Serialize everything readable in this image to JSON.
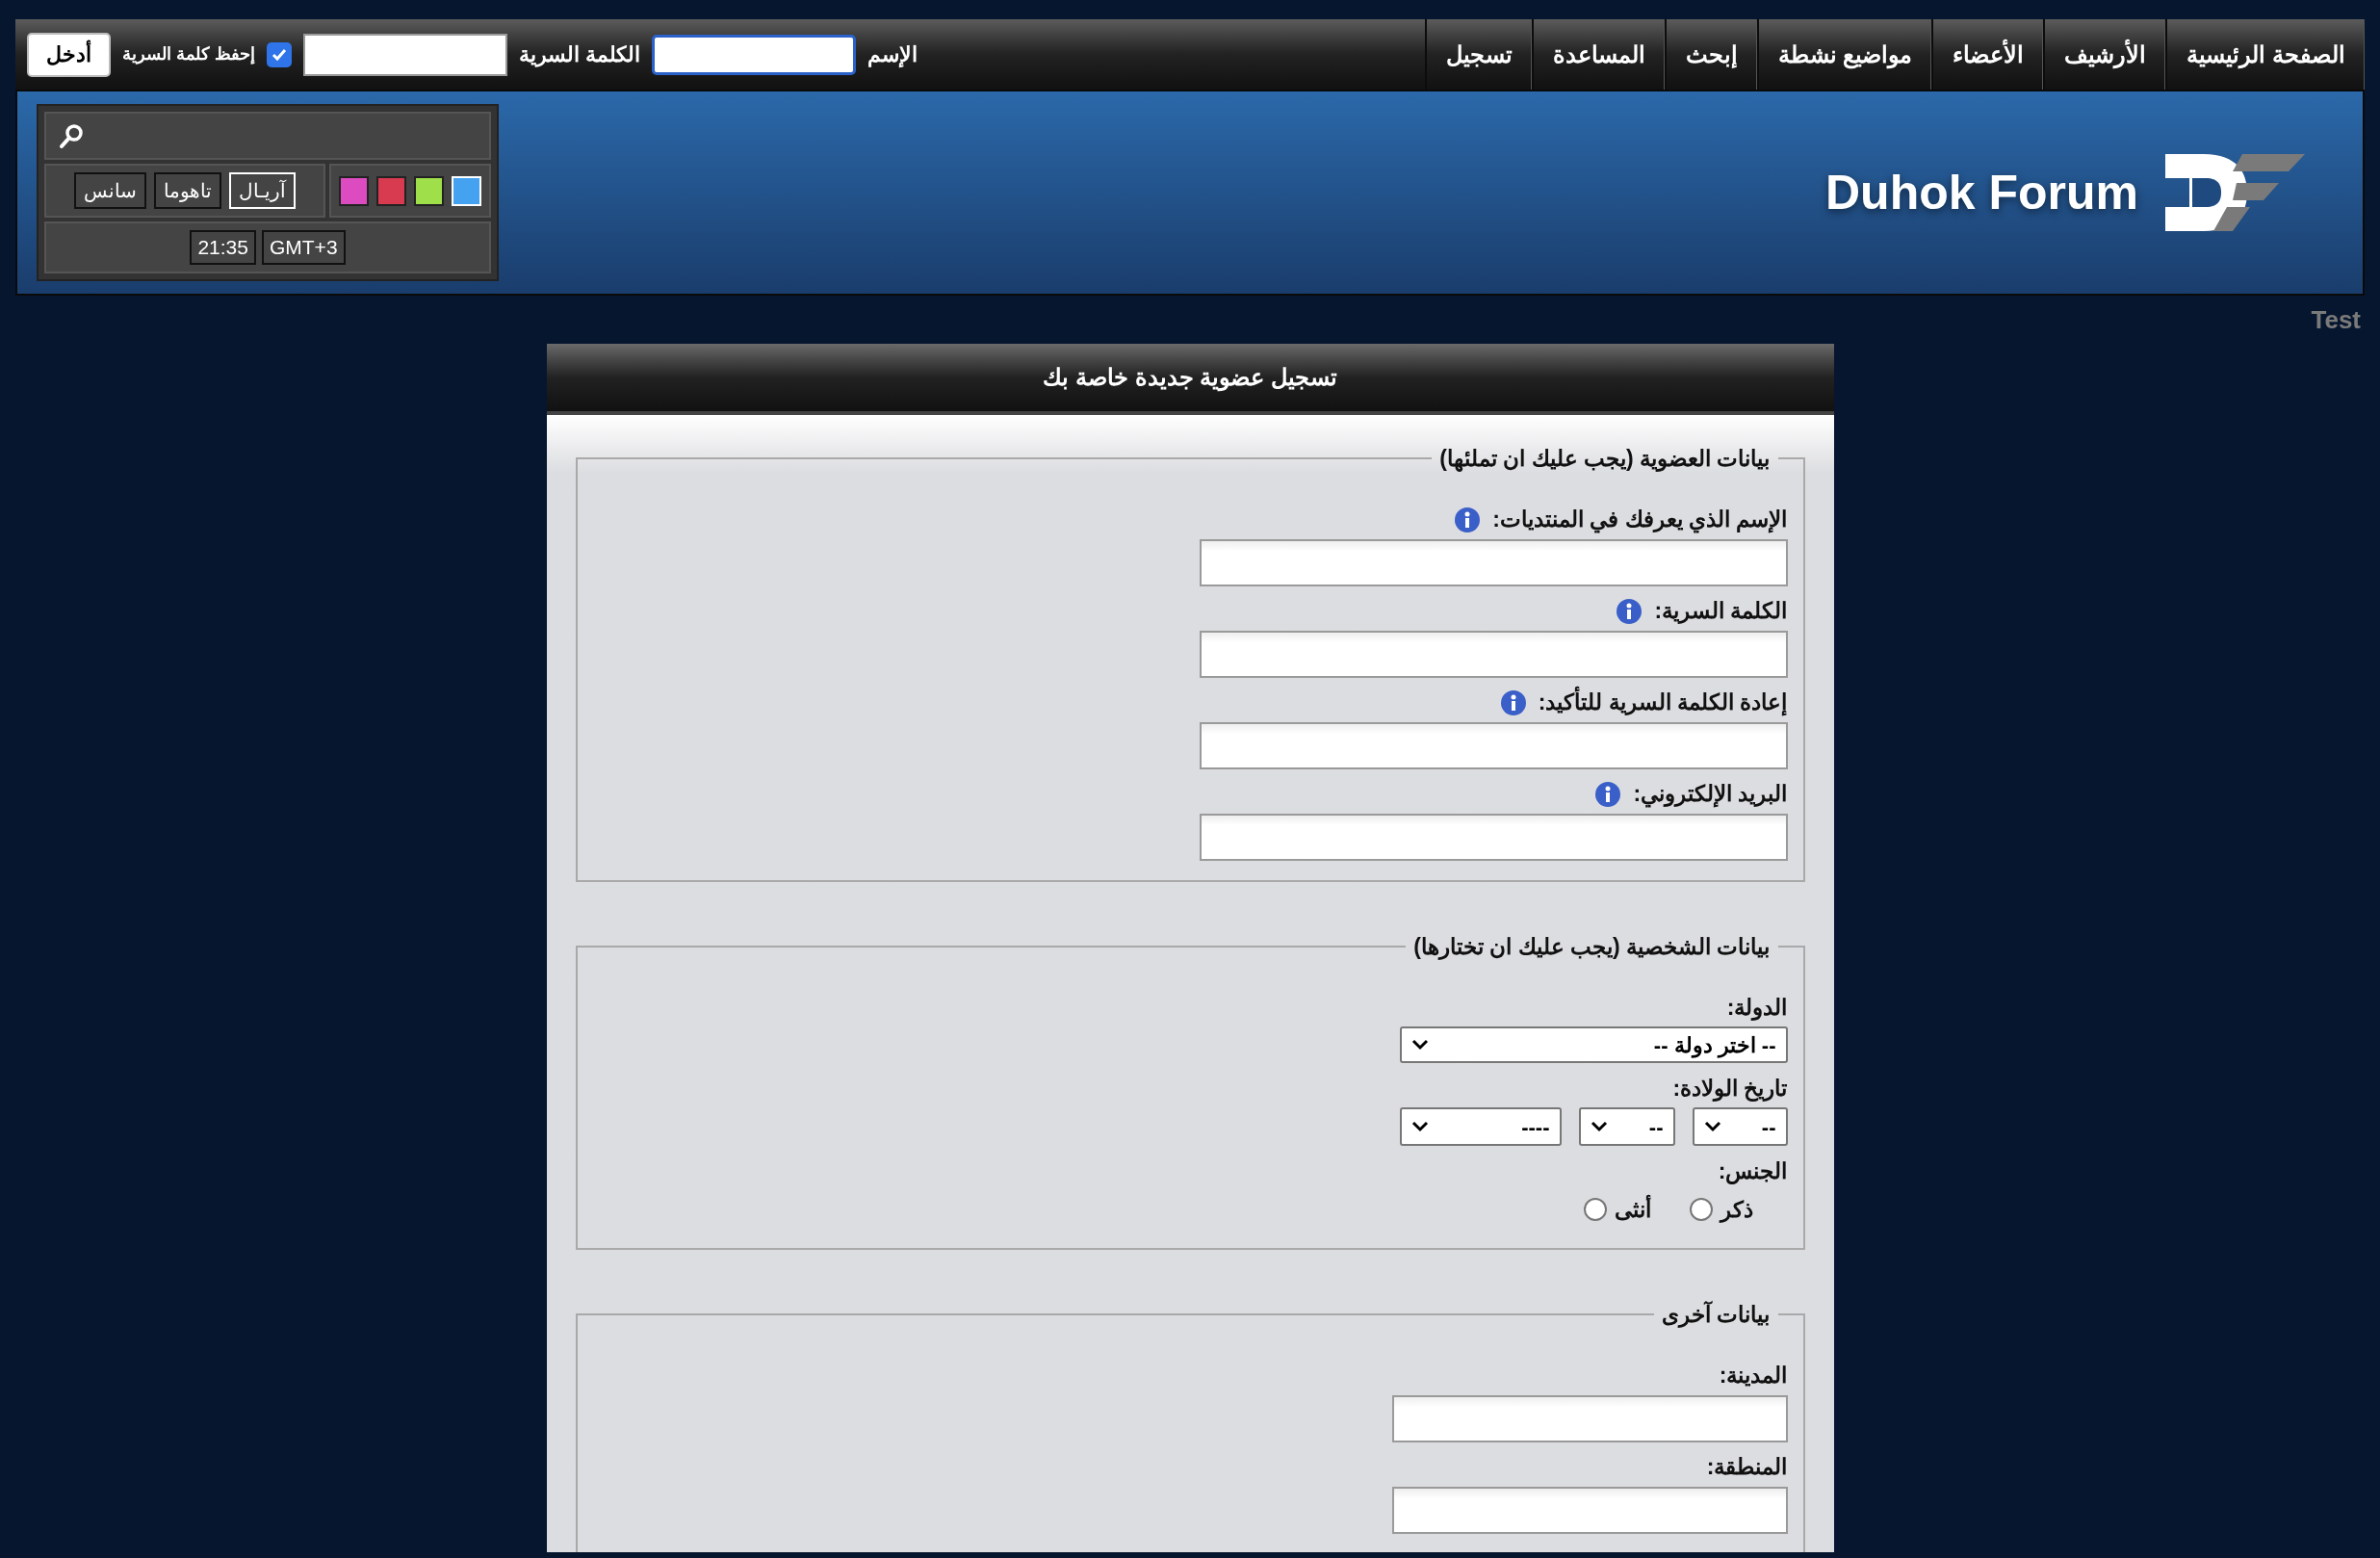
{
  "nav": [
    {
      "label": "الصفحة الرئيسية"
    },
    {
      "label": "الأرشيف"
    },
    {
      "label": "الأعضاء"
    },
    {
      "label": "مواضيع نشطة"
    },
    {
      "label": "إبحث"
    },
    {
      "label": "المساعدة"
    },
    {
      "label": "تسجيل"
    }
  ],
  "login": {
    "username_label": "الإسم",
    "username_focused": true,
    "password_label": "الكلمة السرية",
    "remember_label": "إحفظ كلمة السرية",
    "remember_checked": true,
    "submit": "أدخل"
  },
  "widget": {
    "fonts": [
      {
        "label": "آريـال",
        "selected": true
      },
      {
        "label": "تاهوما",
        "selected": false
      },
      {
        "label": "سانس",
        "selected": false
      }
    ],
    "swatches": [
      {
        "color": "#dd4bc0",
        "selected": false
      },
      {
        "color": "#d83a4f",
        "selected": false
      },
      {
        "color": "#9fe04a",
        "selected": false
      },
      {
        "color": "#44a2f0",
        "selected": true
      }
    ],
    "time": "21:35",
    "timezone": "GMT+3"
  },
  "logo": {
    "text": "Duhok Forum"
  },
  "side_text": "Test",
  "form": {
    "title": "تسجيل عضوية جديدة خاصة بك",
    "sections": [
      {
        "legend": "بيانات العضوية (يجب عليك ان تملئها)",
        "fields": [
          {
            "kind": "text",
            "label": "الإسم الذي يعرفك في المنتديات:",
            "info": true
          },
          {
            "kind": "text",
            "label": "الكلمة السرية:",
            "info": true
          },
          {
            "kind": "text",
            "label": "إعادة الكلمة السرية للتأكيد:",
            "info": true
          },
          {
            "kind": "text",
            "label": "البريد الإلكتروني:",
            "info": true
          }
        ]
      },
      {
        "legend": "بيانات الشخصية (يجب عليك ان تختارها)",
        "fields": [
          {
            "kind": "select",
            "label": "الدولة:",
            "value": "-- اختر دولة --"
          },
          {
            "kind": "date",
            "label": "تاريخ الولادة:",
            "parts": [
              "--",
              "--",
              "----"
            ]
          },
          {
            "kind": "radio",
            "label": "الجنس:",
            "options": [
              {
                "label": "ذكر",
                "selected": false
              },
              {
                "label": "أنثى",
                "selected": false
              }
            ]
          }
        ]
      },
      {
        "legend": "بيانات آخرى",
        "fields": [
          {
            "kind": "short",
            "label": "المدينة:",
            "info": false
          },
          {
            "kind": "short",
            "label": "المنطقة:",
            "info": false
          }
        ]
      }
    ]
  }
}
